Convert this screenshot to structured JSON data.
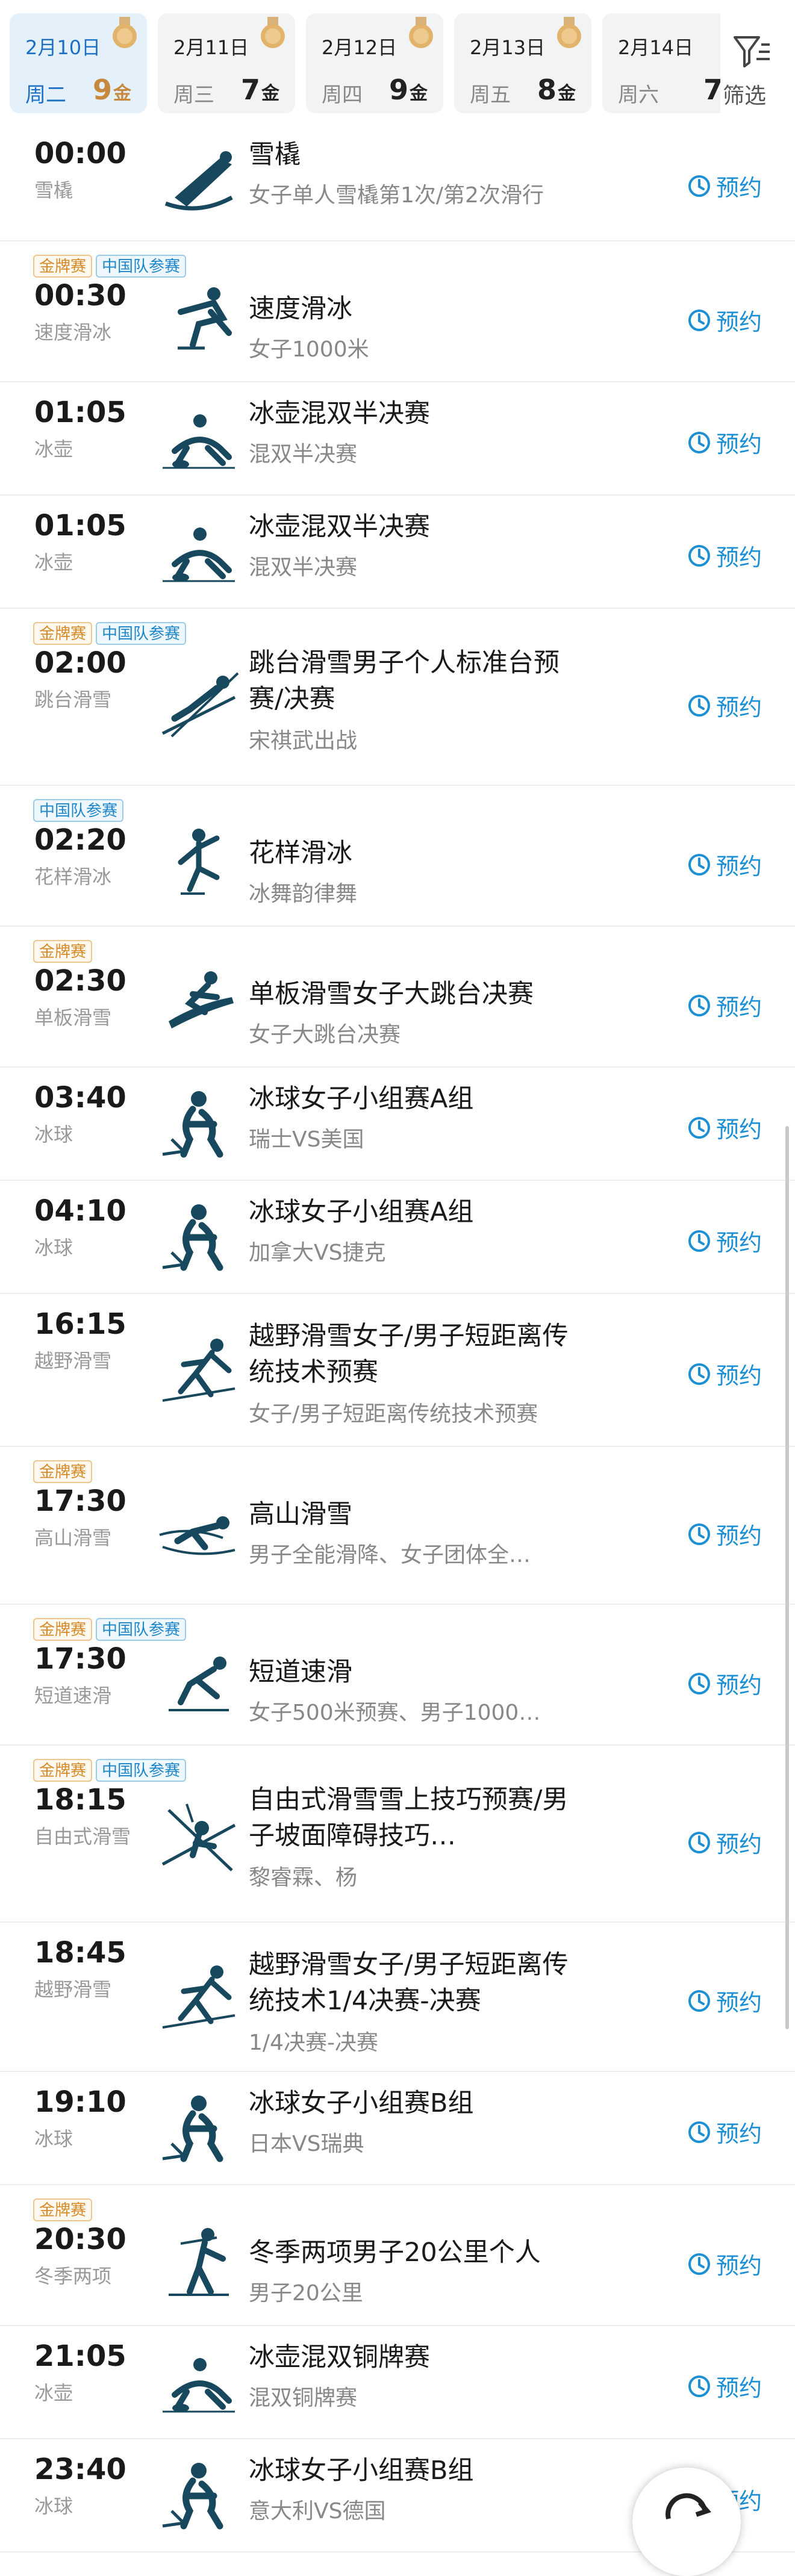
{
  "date_tabs": [
    {
      "date": "2月10日",
      "weekday": "周二",
      "gold": "9",
      "unit": "金",
      "active": true
    },
    {
      "date": "2月11日",
      "weekday": "周三",
      "gold": "7",
      "unit": "金",
      "active": false
    },
    {
      "date": "2月12日",
      "weekday": "周四",
      "gold": "9",
      "unit": "金",
      "active": false
    },
    {
      "date": "2月13日",
      "weekday": "周五",
      "gold": "8",
      "unit": "金",
      "active": false
    },
    {
      "date": "2月14日",
      "weekday": "周六",
      "gold": "7",
      "unit": "",
      "active": false
    }
  ],
  "filter_label": "筛选",
  "book_label": "预约",
  "events": [
    {
      "time": "00:00",
      "sport": "雪橇",
      "tags": [],
      "title": "雪橇",
      "sub": "女子单人雪橇第1次/第2次滑行",
      "icon": "luge-icon"
    },
    {
      "time": "00:30",
      "sport": "速度滑冰",
      "tags": [
        "金牌赛",
        "中国队参赛"
      ],
      "title": "速度滑冰",
      "sub": "女子1000米",
      "icon": "speed-skating-icon"
    },
    {
      "time": "01:05",
      "sport": "冰壶",
      "tags": [],
      "title": "冰壶混双半决赛",
      "sub": "混双半决赛",
      "icon": "curling-icon"
    },
    {
      "time": "01:05",
      "sport": "冰壶",
      "tags": [],
      "title": "冰壶混双半决赛",
      "sub": "混双半决赛",
      "icon": "curling-icon"
    },
    {
      "time": "02:00",
      "sport": "跳台滑雪",
      "tags": [
        "金牌赛",
        "中国队参赛"
      ],
      "title": "跳台滑雪男子个人标准台预赛/决赛",
      "sub": "宋祺武出战",
      "icon": "ski-jumping-icon"
    },
    {
      "time": "02:20",
      "sport": "花样滑冰",
      "tags": [
        "中国队参赛"
      ],
      "title": "花样滑冰",
      "sub": "冰舞韵律舞",
      "icon": "figure-skating-icon"
    },
    {
      "time": "02:30",
      "sport": "单板滑雪",
      "tags": [
        "金牌赛"
      ],
      "title": "单板滑雪女子大跳台决赛",
      "sub": "女子大跳台决赛",
      "icon": "snowboard-icon"
    },
    {
      "time": "03:40",
      "sport": "冰球",
      "tags": [],
      "title": "冰球女子小组赛A组",
      "sub": "瑞士VS美国",
      "icon": "ice-hockey-icon"
    },
    {
      "time": "04:10",
      "sport": "冰球",
      "tags": [],
      "title": "冰球女子小组赛A组",
      "sub": "加拿大VS捷克",
      "icon": "ice-hockey-icon"
    },
    {
      "time": "16:15",
      "sport": "越野滑雪",
      "tags": [],
      "title": "越野滑雪女子/男子短距离传统技术预赛",
      "sub": "女子/男子短距离传统技术预赛",
      "icon": "cross-country-icon"
    },
    {
      "time": "17:30",
      "sport": "高山滑雪",
      "tags": [
        "金牌赛"
      ],
      "title": "高山滑雪",
      "sub": "男子全能滑降、女子团体全…",
      "icon": "alpine-ski-icon"
    },
    {
      "time": "17:30",
      "sport": "短道速滑",
      "tags": [
        "金牌赛",
        "中国队参赛"
      ],
      "title": "短道速滑",
      "sub": "女子500米预赛、男子1000…",
      "icon": "short-track-icon"
    },
    {
      "time": "18:15",
      "sport": "自由式滑雪",
      "tags": [
        "金牌赛",
        "中国队参赛"
      ],
      "title": "自由式滑雪雪上技巧预赛/男子坡面障碍技巧…",
      "sub": "黎睿霖、杨",
      "icon": "freestyle-icon"
    },
    {
      "time": "18:45",
      "sport": "越野滑雪",
      "tags": [],
      "title": "越野滑雪女子/男子短距离传统技术1/4决赛-决赛",
      "sub": "1/4决赛-决赛",
      "icon": "cross-country-icon"
    },
    {
      "time": "19:10",
      "sport": "冰球",
      "tags": [],
      "title": "冰球女子小组赛B组",
      "sub": "日本VS瑞典",
      "icon": "ice-hockey-icon"
    },
    {
      "time": "20:30",
      "sport": "冬季两项",
      "tags": [
        "金牌赛"
      ],
      "title": "冬季两项男子20公里个人",
      "sub": "男子20公里",
      "icon": "biathlon-icon"
    },
    {
      "time": "21:05",
      "sport": "冰壶",
      "tags": [],
      "title": "冰壶混双铜牌赛",
      "sub": "混双铜牌赛",
      "icon": "curling-icon"
    },
    {
      "time": "23:40",
      "sport": "冰球",
      "tags": [],
      "title": "冰球女子小组赛B组",
      "sub": "意大利VS德国",
      "icon": "ice-hockey-icon"
    }
  ],
  "colors": {
    "accent": "#1d8fd4",
    "gold": "#d58a28",
    "active_tab_bg": "#e4f1fb"
  }
}
